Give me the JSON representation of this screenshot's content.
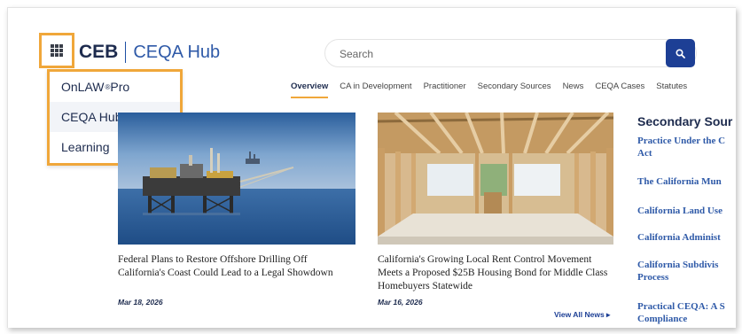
{
  "header": {
    "brand": "CEB",
    "product": "CEQA Hub",
    "search_placeholder": "Search"
  },
  "app_menu": {
    "items": [
      {
        "label": "OnLAW",
        "suffix": "®",
        "label_tail": " Pro"
      },
      {
        "label": "CEQA Hub",
        "suffix": "",
        "label_tail": ""
      },
      {
        "label": "Learning",
        "suffix": "",
        "label_tail": ""
      }
    ]
  },
  "nav": {
    "tabs": [
      "Overview",
      "CA in Development",
      "Practitioner",
      "Secondary Sources",
      "News",
      "CEQA Cases",
      "Statutes"
    ]
  },
  "articles": [
    {
      "headline": "Federal Plans to Restore Offshore Drilling Off California's Coast Could Lead to a Legal Showdown",
      "date": "Mar 18, 2026"
    },
    {
      "headline": "California's Growing Local Rent Control Movement Meets a Proposed $25B Housing Bond for Middle Class Homebuyers Statewide",
      "date": "Mar 16, 2026"
    }
  ],
  "view_all_label": "View All News ▸",
  "sidebar": {
    "title": "Secondary Sour",
    "links": [
      {
        "line1": "Practice Under the C",
        "line2": "Act"
      },
      {
        "line1": "The California Mun",
        "line2": ""
      },
      {
        "line1": "California Land Use",
        "line2": ""
      },
      {
        "line1": "California Administ",
        "line2": ""
      },
      {
        "line1": "California Subdivis",
        "line2": "Process"
      },
      {
        "line1": "Practical CEQA: A S",
        "line2": "Compliance"
      }
    ]
  },
  "colors": {
    "accent": "#f0a73a",
    "navy": "#1d2b4e",
    "link_blue": "#2f5aa8",
    "search_button": "#1d3f95"
  }
}
